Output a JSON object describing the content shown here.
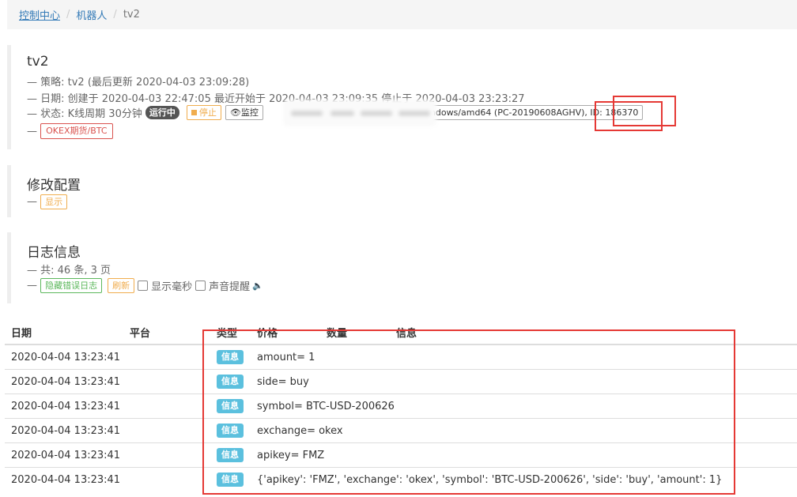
{
  "breadcrumb": {
    "home": "控制中心",
    "robots": "机器人",
    "current": "tv2"
  },
  "robot": {
    "name": "tv2",
    "strategy_line": "— 策略: tv2 (最后更新 2020-04-03 23:09:28)",
    "date_line": "— 日期: 创建于 2020-04-03 22:47:05 最近开始于 2020-04-03 23:09:35 停止于 2020-04-03 23:23:27",
    "status_prefix": "— 状态: K线周期 30分钟",
    "status_badge": "运行中",
    "stop_label": "停止",
    "monitor_label": "监控",
    "docker_text": "windows/amd64 (PC-20190608AGHV), ID: 186370",
    "exchange_label": "OKEX期货/BTC"
  },
  "config": {
    "title": "修改配置",
    "show_label": "显示"
  },
  "log": {
    "title": "日志信息",
    "summary": "— 共: 46 条, 3 页",
    "hide_errors_label": "隐藏错误日志",
    "refresh_label": "刷新",
    "show_ms_label": "显示毫秒",
    "sound_label": "声音提醒"
  },
  "table": {
    "headers": {
      "date": "日期",
      "platform": "平台",
      "type": "类型",
      "price": "价格",
      "amount": "数量",
      "info": "信息"
    },
    "rows": [
      {
        "date": "2020-04-04 13:23:41",
        "platform": "",
        "type": "信息",
        "msg": "amount= 1"
      },
      {
        "date": "2020-04-04 13:23:41",
        "platform": "",
        "type": "信息",
        "msg": "side= buy"
      },
      {
        "date": "2020-04-04 13:23:41",
        "platform": "",
        "type": "信息",
        "msg": "symbol= BTC-USD-200626"
      },
      {
        "date": "2020-04-04 13:23:41",
        "platform": "",
        "type": "信息",
        "msg": "exchange= okex"
      },
      {
        "date": "2020-04-04 13:23:41",
        "platform": "",
        "type": "信息",
        "msg": "apikey= FMZ"
      },
      {
        "date": "2020-04-04 13:23:41",
        "platform": "",
        "type": "信息",
        "msg": "{'apikey': 'FMZ', 'exchange': 'okex', 'symbol': 'BTC-USD-200626', 'side': 'buy', 'amount': 1}"
      }
    ]
  },
  "colors": {
    "annotation_red": "#e53935",
    "info_label": "#5bc0de",
    "link": "#337ab7"
  }
}
